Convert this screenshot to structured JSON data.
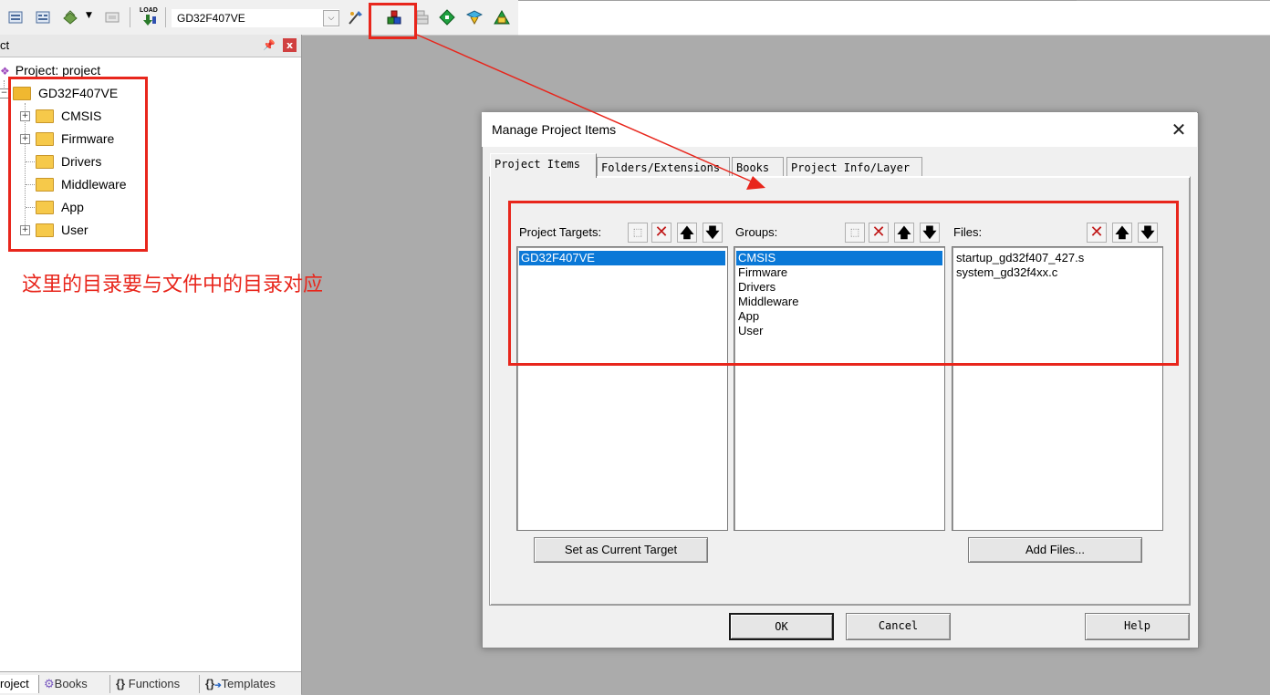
{
  "toolbar": {
    "target_name": "GD32F407VE",
    "load_label": "LOAD",
    "icons": [
      "batch-build-icon",
      "rebuild-icon",
      "translate-icon",
      "stop-build-icon",
      "download-icon",
      "manage-project-items-icon",
      "select-packs-icon",
      "manage-rte-icon",
      "pack-installer-icon",
      "options-target-icon"
    ]
  },
  "project_panel": {
    "title": "ct",
    "root_label": "Project: project",
    "target_label": "GD32F407VE",
    "groups": [
      {
        "label": "CMSIS",
        "expandable": true
      },
      {
        "label": "Firmware",
        "expandable": true
      },
      {
        "label": "Drivers",
        "expandable": false
      },
      {
        "label": "Middleware",
        "expandable": false
      },
      {
        "label": "App",
        "expandable": false
      },
      {
        "label": "User",
        "expandable": true
      }
    ],
    "bottom_tabs": [
      "roject",
      "Books",
      "Functions",
      "Templates"
    ]
  },
  "annotation": {
    "text": "这里的目录要与文件中的目录对应",
    "color": "#e8261c"
  },
  "dialog": {
    "title": "Manage Project Items",
    "close_glyph": "✕",
    "tabs": [
      "Project Items",
      "Folders/Extensions",
      "Books",
      "Project Info/Layer"
    ],
    "active_tab": "Project Items",
    "targets_header": "Project Targets:",
    "groups_header": "Groups:",
    "files_header": "Files:",
    "targets": [
      "GD32F407VE"
    ],
    "selected_target": "GD32F407VE",
    "groups": [
      "CMSIS",
      "Firmware",
      "Drivers",
      "Middleware",
      "App",
      "User"
    ],
    "selected_group": "CMSIS",
    "files": [
      "startup_gd32f407_427.s",
      "system_gd32f4xx.c"
    ],
    "set_current_label": "Set as Current Target",
    "add_files_label": "Add Files...",
    "ok_label": "OK",
    "cancel_label": "Cancel",
    "help_label": "Help"
  },
  "colors": {
    "selection": "#0a78d7",
    "annotation_red": "#e8261c",
    "workspace_bg": "#ababab"
  }
}
